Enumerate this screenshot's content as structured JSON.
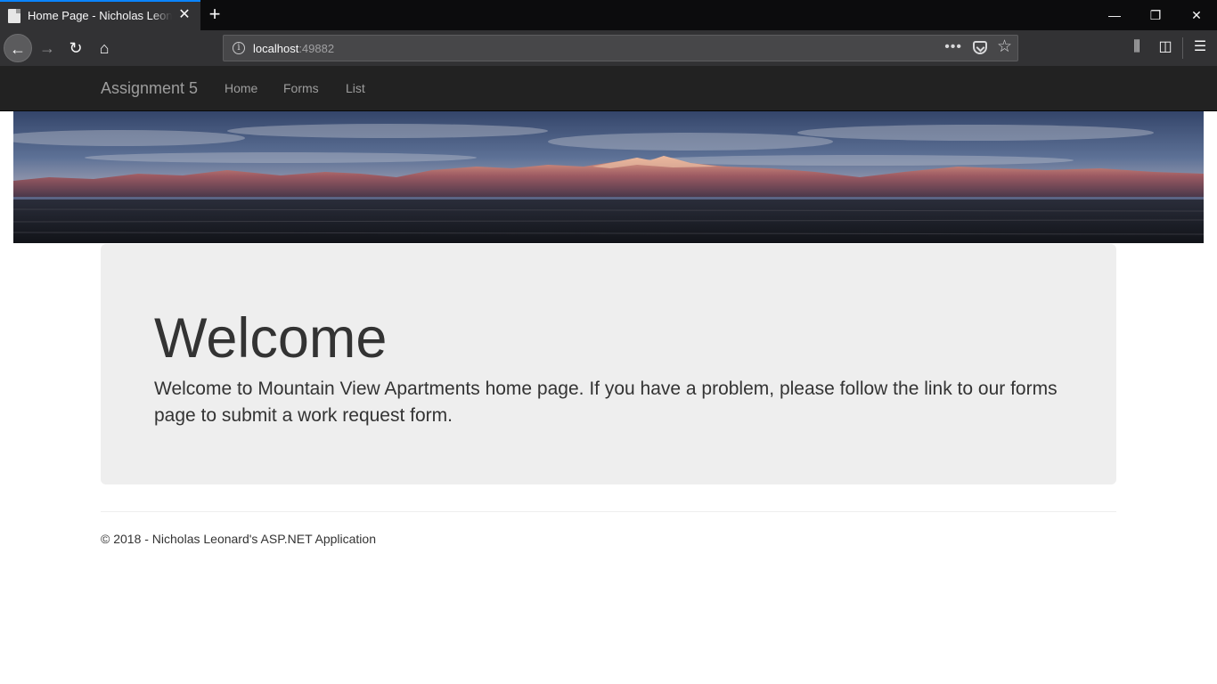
{
  "browser": {
    "tab_title": "Home Page - Nicholas Leonard's ASP.NET Application",
    "url_host": "localhost",
    "url_port": ":49882",
    "icons": {
      "tab_favicon": "document-icon",
      "tab_close": "close-icon",
      "new_tab": "plus-icon",
      "back": "arrow-left-icon",
      "forward": "arrow-right-icon",
      "reload": "reload-icon",
      "home": "home-icon",
      "site_info": "info-icon",
      "page_actions": "more-icon",
      "pocket": "pocket-icon",
      "bookmark": "star-icon",
      "library": "library-icon",
      "sidebar": "sidebar-icon",
      "menu": "hamburger-menu-icon",
      "minimize": "minimize-icon",
      "restore": "restore-icon",
      "close_window": "close-icon"
    },
    "glyphs": {
      "close": "✕",
      "plus": "+",
      "back": "←",
      "forward": "→",
      "reload": "↻",
      "home": "⌂",
      "info": "i",
      "more": "•••",
      "star": "☆",
      "library": "⫼",
      "sidebar": "◫",
      "menu": "☰",
      "minimize": "—",
      "restore": "❐",
      "close_window": "✕"
    },
    "colors": {
      "accent": "#0a84ff",
      "toolbar": "#323234",
      "tabstrip": "#0c0c0d"
    }
  },
  "site": {
    "brand": "Assignment 5",
    "nav": [
      {
        "label": "Home"
      },
      {
        "label": "Forms"
      },
      {
        "label": "List"
      }
    ],
    "banner_image": "mountain-panorama-banner"
  },
  "main": {
    "title": "Welcome",
    "text": "Welcome to Mountain View Apartments home page. If you have a problem, please follow the link to our forms page to submit a work request form."
  },
  "footer": {
    "text": "© 2018 - Nicholas Leonard's ASP.NET Application"
  }
}
